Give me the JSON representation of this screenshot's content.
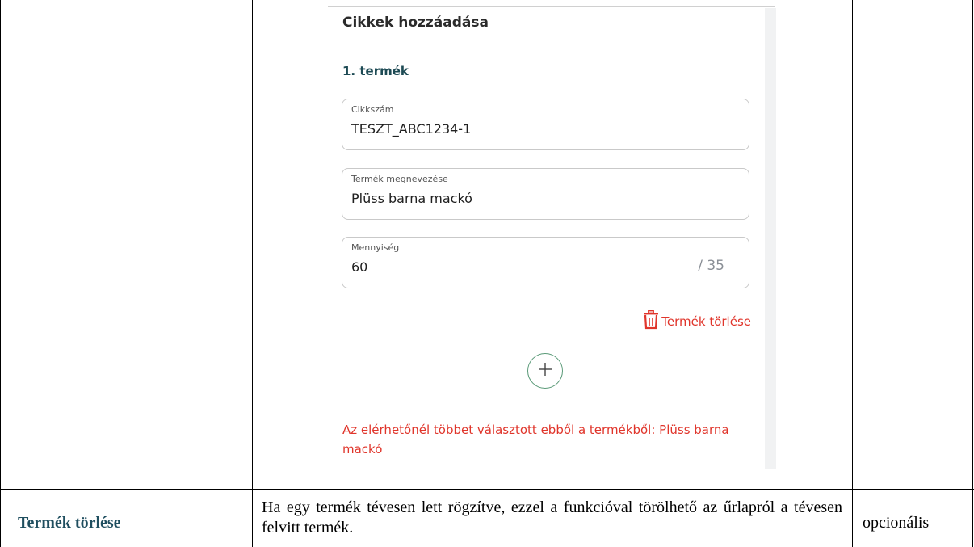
{
  "form": {
    "title": "Cikkek hozzáadása",
    "product_heading": "1. termék",
    "fields": [
      {
        "label": "Cikkszám",
        "value": "TESZT_ABC1234-1"
      },
      {
        "label": "Termék megnevezése",
        "value": "Plüss barna mackó"
      },
      {
        "label": "Mennyiség",
        "value": "60",
        "max": "/ 35"
      }
    ],
    "delete_label": "Termék törlése",
    "error_message": "Az elérhetőnél többet választott ebből a termékből: Plüss barna mackó"
  },
  "row": {
    "feature": "Termék törlése",
    "description": "Ha egy termék tévesen lett rögzítve, ezzel a funkcióval törölhető az űrlapról a tévesen felvitt termék.",
    "requirement": "opcionális"
  },
  "colors": {
    "error": "#e0352b",
    "heading": "#1d4a54",
    "add_button_border": "#5a9a78"
  }
}
